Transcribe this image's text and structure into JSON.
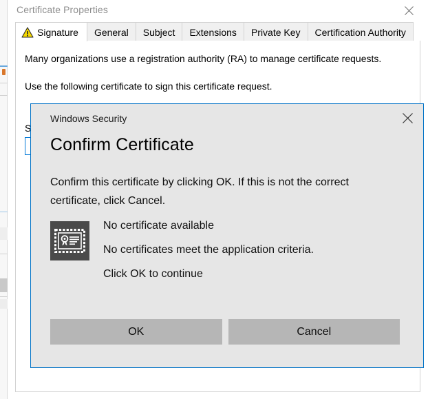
{
  "background_sliver": {
    "name": "background-window-edge",
    "accent_orange": "#d9772b",
    "accent_blue": "#6aa9dd"
  },
  "window": {
    "title": "Certificate Properties",
    "close_icon": "close-icon",
    "title_color": "#8d8d8d"
  },
  "tabs": [
    {
      "label": "Signature",
      "icon": "warning-triangle-icon",
      "active": true
    },
    {
      "label": "General",
      "icon": "",
      "active": false
    },
    {
      "label": "Subject",
      "icon": "",
      "active": false
    },
    {
      "label": "Extensions",
      "icon": "",
      "active": false
    },
    {
      "label": "Private Key",
      "icon": "",
      "active": false
    },
    {
      "label": "Certification Authority",
      "icon": "",
      "active": false
    }
  ],
  "page": {
    "paragraph_1": "Many organizations use a registration authority (RA) to manage certificate requests.",
    "paragraph_2": "Use the following certificate to sign this certificate request.",
    "combo_label": "Signature certificate:",
    "combo_value": "",
    "combo_arrow_icon": "chevron-down-icon",
    "focus_color": "#0078d7"
  },
  "dialog": {
    "title": "Windows Security",
    "close_icon": "close-icon",
    "heading": "Confirm Certificate",
    "body": "Confirm this certificate by clicking OK. If this is not the correct certificate, click Cancel.",
    "cert_icon": "certificate-icon",
    "cert_lines": [
      "No certificate available",
      "No certificates meet the application criteria.",
      "Click OK to continue"
    ],
    "buttons": {
      "ok": "OK",
      "cancel": "Cancel"
    },
    "border_color": "#0072c6",
    "surface_color": "#e6e6e6",
    "button_color": "#b6b6b6"
  }
}
